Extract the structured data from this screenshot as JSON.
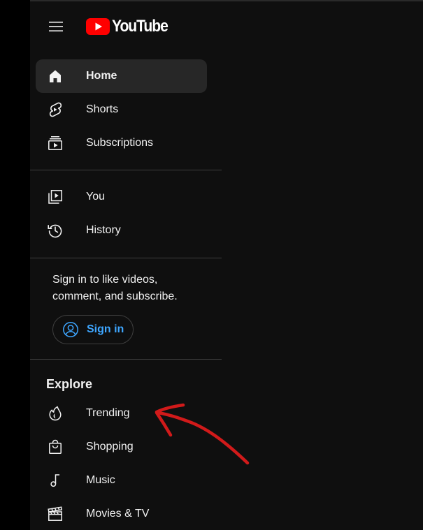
{
  "header": {
    "menu_icon": "hamburger-menu-icon",
    "logo_text": "YouTube",
    "logo_color": "#ff0000"
  },
  "nav_primary": [
    {
      "label": "Home",
      "icon": "home-icon",
      "active": true
    },
    {
      "label": "Shorts",
      "icon": "shorts-icon",
      "active": false
    },
    {
      "label": "Subscriptions",
      "icon": "subscriptions-icon",
      "active": false
    }
  ],
  "nav_you": [
    {
      "label": "You",
      "icon": "you-library-icon"
    },
    {
      "label": "History",
      "icon": "history-icon"
    }
  ],
  "signin": {
    "prompt": "Sign in to like videos, comment, and subscribe.",
    "button_label": "Sign in",
    "button_icon": "account-circle-icon",
    "accent_color": "#3ea6ff"
  },
  "explore": {
    "title": "Explore",
    "items": [
      {
        "label": "Trending",
        "icon": "trending-flame-icon"
      },
      {
        "label": "Shopping",
        "icon": "shopping-bag-icon"
      },
      {
        "label": "Music",
        "icon": "music-note-icon"
      },
      {
        "label": "Movies & TV",
        "icon": "movies-clapperboard-icon"
      }
    ]
  },
  "annotation": {
    "icon": "red-arrow-icon",
    "color": "#d11a1a"
  }
}
